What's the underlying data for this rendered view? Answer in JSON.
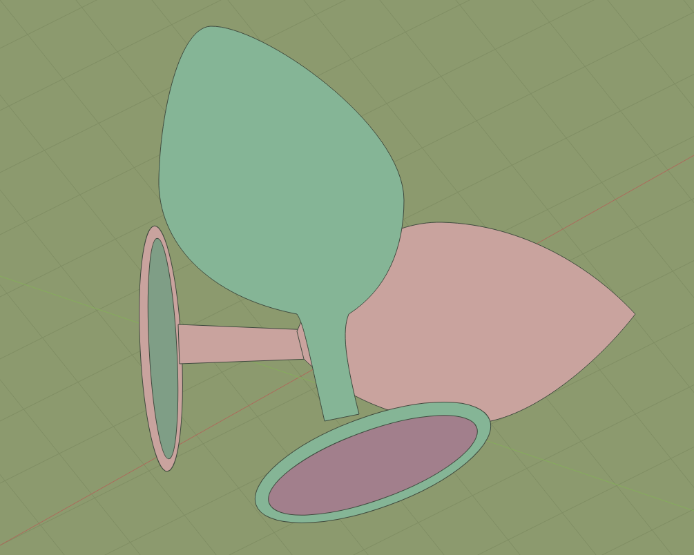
{
  "viewport": {
    "models": [
      {
        "color": "#c9a39e"
      },
      {
        "color": "#85b596"
      }
    ]
  }
}
